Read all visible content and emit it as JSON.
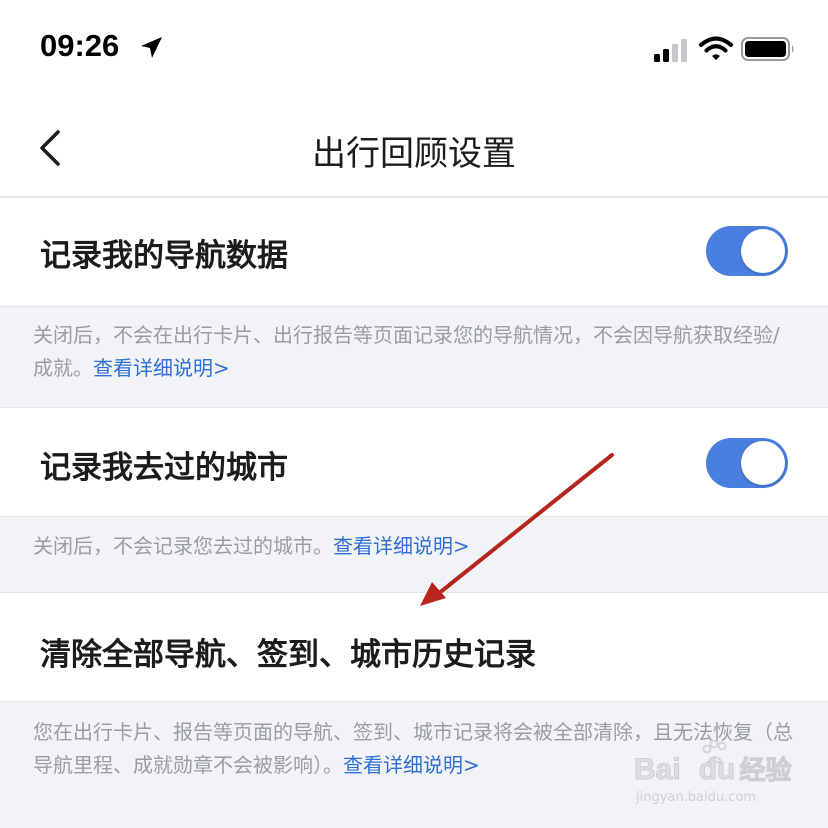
{
  "status_bar": {
    "time": "09:26",
    "icons": [
      "location-arrow-icon",
      "cellular-signal-icon",
      "wifi-icon",
      "battery-icon"
    ]
  },
  "nav": {
    "title": "出行回顾设置",
    "back_icon": "chevron-left-icon"
  },
  "settings": [
    {
      "label": "记录我的导航数据",
      "toggle_on": true,
      "description": "关闭后，不会在出行卡片、出行报告等页面记录您的导航情况，不会因导航获取经验/成就。",
      "link": "查看详细说明>"
    },
    {
      "label": "记录我去过的城市",
      "toggle_on": true,
      "description": "关闭后，不会记录您去过的城市。",
      "link": "查看详细说明>"
    },
    {
      "label": "清除全部导航、签到、城市历史记录",
      "description": "您在出行卡片、报告等页面的导航、签到、城市记录将会被全部清除，且无法恢复（总导航里程、成就勋章不会被影响）。",
      "link": "查看详细说明>"
    }
  ],
  "watermark": {
    "brand": "Bai",
    "brand2": "du",
    "product": "经验",
    "url": "jingyan.baidu.com"
  },
  "colors": {
    "accent_blue": "#2f6fd6",
    "toggle_on": "#4a7fe0",
    "annotation_arrow": "#b5261e",
    "page_bg": "#f2f3f7"
  }
}
